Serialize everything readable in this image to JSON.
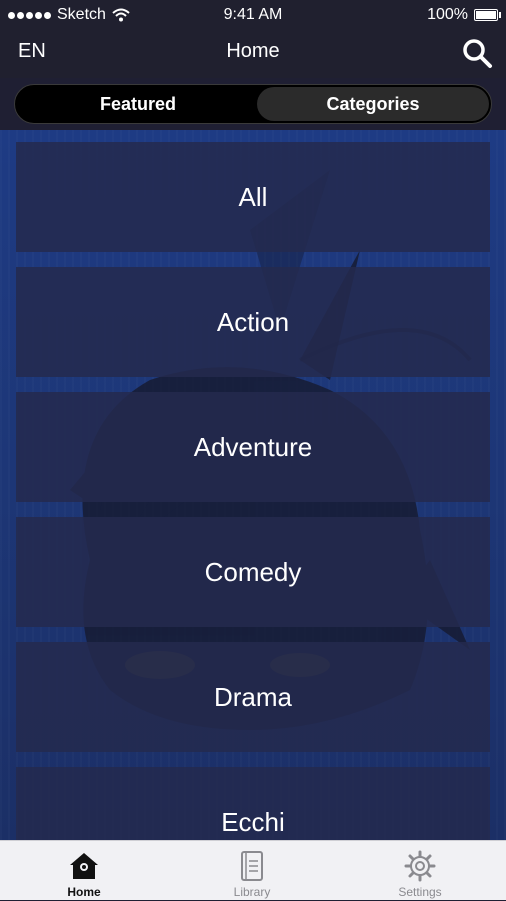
{
  "status_bar": {
    "carrier": "Sketch",
    "time": "9:41 AM",
    "battery": "100%"
  },
  "nav": {
    "language": "EN",
    "title": "Home",
    "search_icon": "search-icon"
  },
  "segments": {
    "featured": "Featured",
    "categories": "Categories",
    "selected": "featured"
  },
  "categories": [
    "All",
    "Action",
    "Adventure",
    "Comedy",
    "Drama",
    "Ecchi"
  ],
  "tabs": [
    {
      "label": "Home",
      "icon": "home-icon",
      "active": true
    },
    {
      "label": "Library",
      "icon": "library-icon",
      "active": false
    },
    {
      "label": "Settings",
      "icon": "gear-icon",
      "active": false
    }
  ],
  "colors": {
    "accent": "#1e3b84",
    "card": "#242a4e",
    "bar": "#20202f"
  }
}
